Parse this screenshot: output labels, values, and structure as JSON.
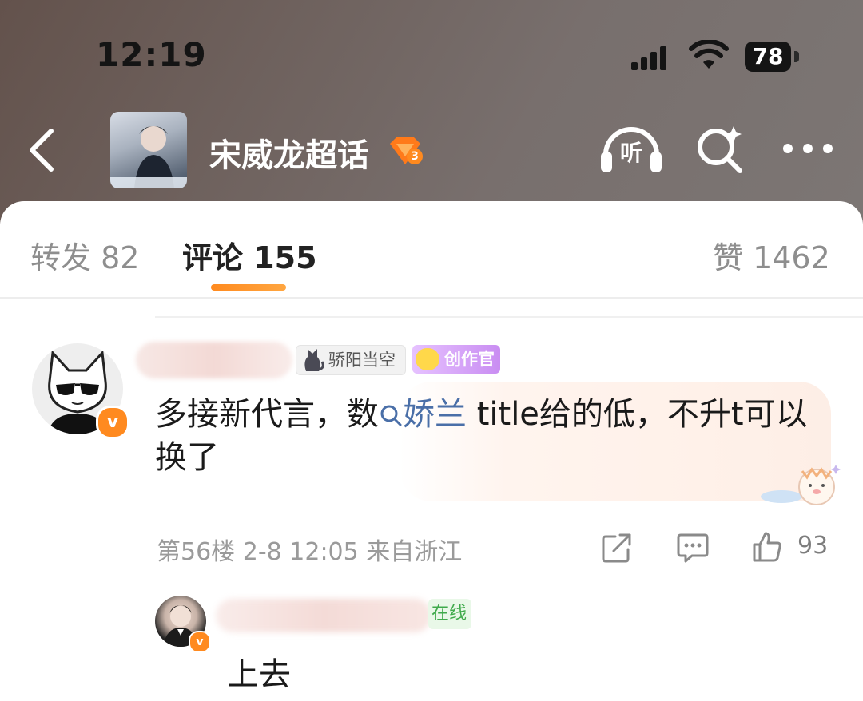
{
  "status_bar": {
    "time": "12:19",
    "battery": "78"
  },
  "header": {
    "topic_title": "宋威龙超话",
    "level": "3",
    "listen_label": "听"
  },
  "tabs": {
    "repost": "转发 82",
    "comment": "评论 155",
    "like": "赞 1462"
  },
  "comment": {
    "fan_badge": "骄阳当空",
    "creator_badge": "创作官",
    "text_before": "多接新代言，数",
    "link_text": "娇兰",
    "text_after": " title给的低，不升t可以换了",
    "floor": "第56楼",
    "date": "2-8 12:05",
    "location": "来自浙江",
    "like_count": "93"
  },
  "reply": {
    "online_badge": "在线",
    "text": "上去"
  },
  "colors": {
    "accent": "#ff8a1f",
    "link": "#4a6fa8",
    "muted": "#9a9a9a"
  },
  "icons": [
    "back-icon",
    "listen-icon",
    "search-sparkle-icon",
    "more-icon",
    "share-icon",
    "comment-icon",
    "thumbs-up-icon"
  ]
}
